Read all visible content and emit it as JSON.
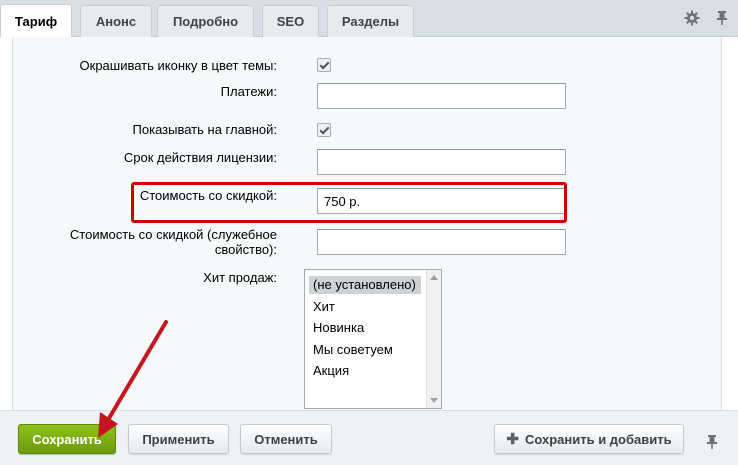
{
  "tabs": [
    {
      "label": "Тариф",
      "active": true
    },
    {
      "label": "Анонс",
      "active": false
    },
    {
      "label": "Подробно",
      "active": false
    },
    {
      "label": "SEO",
      "active": false
    },
    {
      "label": "Разделы",
      "active": false
    }
  ],
  "fields": {
    "theme_icon_color": {
      "label": "Окрашивать иконку в цвет темы:",
      "checked": true
    },
    "payments": {
      "label": "Платежи:",
      "value": ""
    },
    "show_on_main": {
      "label": "Показывать на главной:",
      "checked": true
    },
    "license_term": {
      "label": "Срок действия лицензии:",
      "value": ""
    },
    "discount_price": {
      "label": "Стоимость со скидкой:",
      "value": "750 р."
    },
    "discount_price_service": {
      "label_line1": "Стоимость со скидкой (служебное",
      "label_line2": "свойство):",
      "value": ""
    },
    "bestseller": {
      "label": "Хит продаж:",
      "options": [
        "(не установлено)",
        "Хит",
        "Новинка",
        "Мы советуем",
        "Акция"
      ],
      "selected": "(не установлено)"
    }
  },
  "footer": {
    "save_label": "Сохранить",
    "apply_label": "Применить",
    "cancel_label": "Отменить",
    "save_add_label": "Сохранить и добавить"
  },
  "colors": {
    "accent_green": "#7cad14",
    "highlight_red": "#cc0000"
  }
}
